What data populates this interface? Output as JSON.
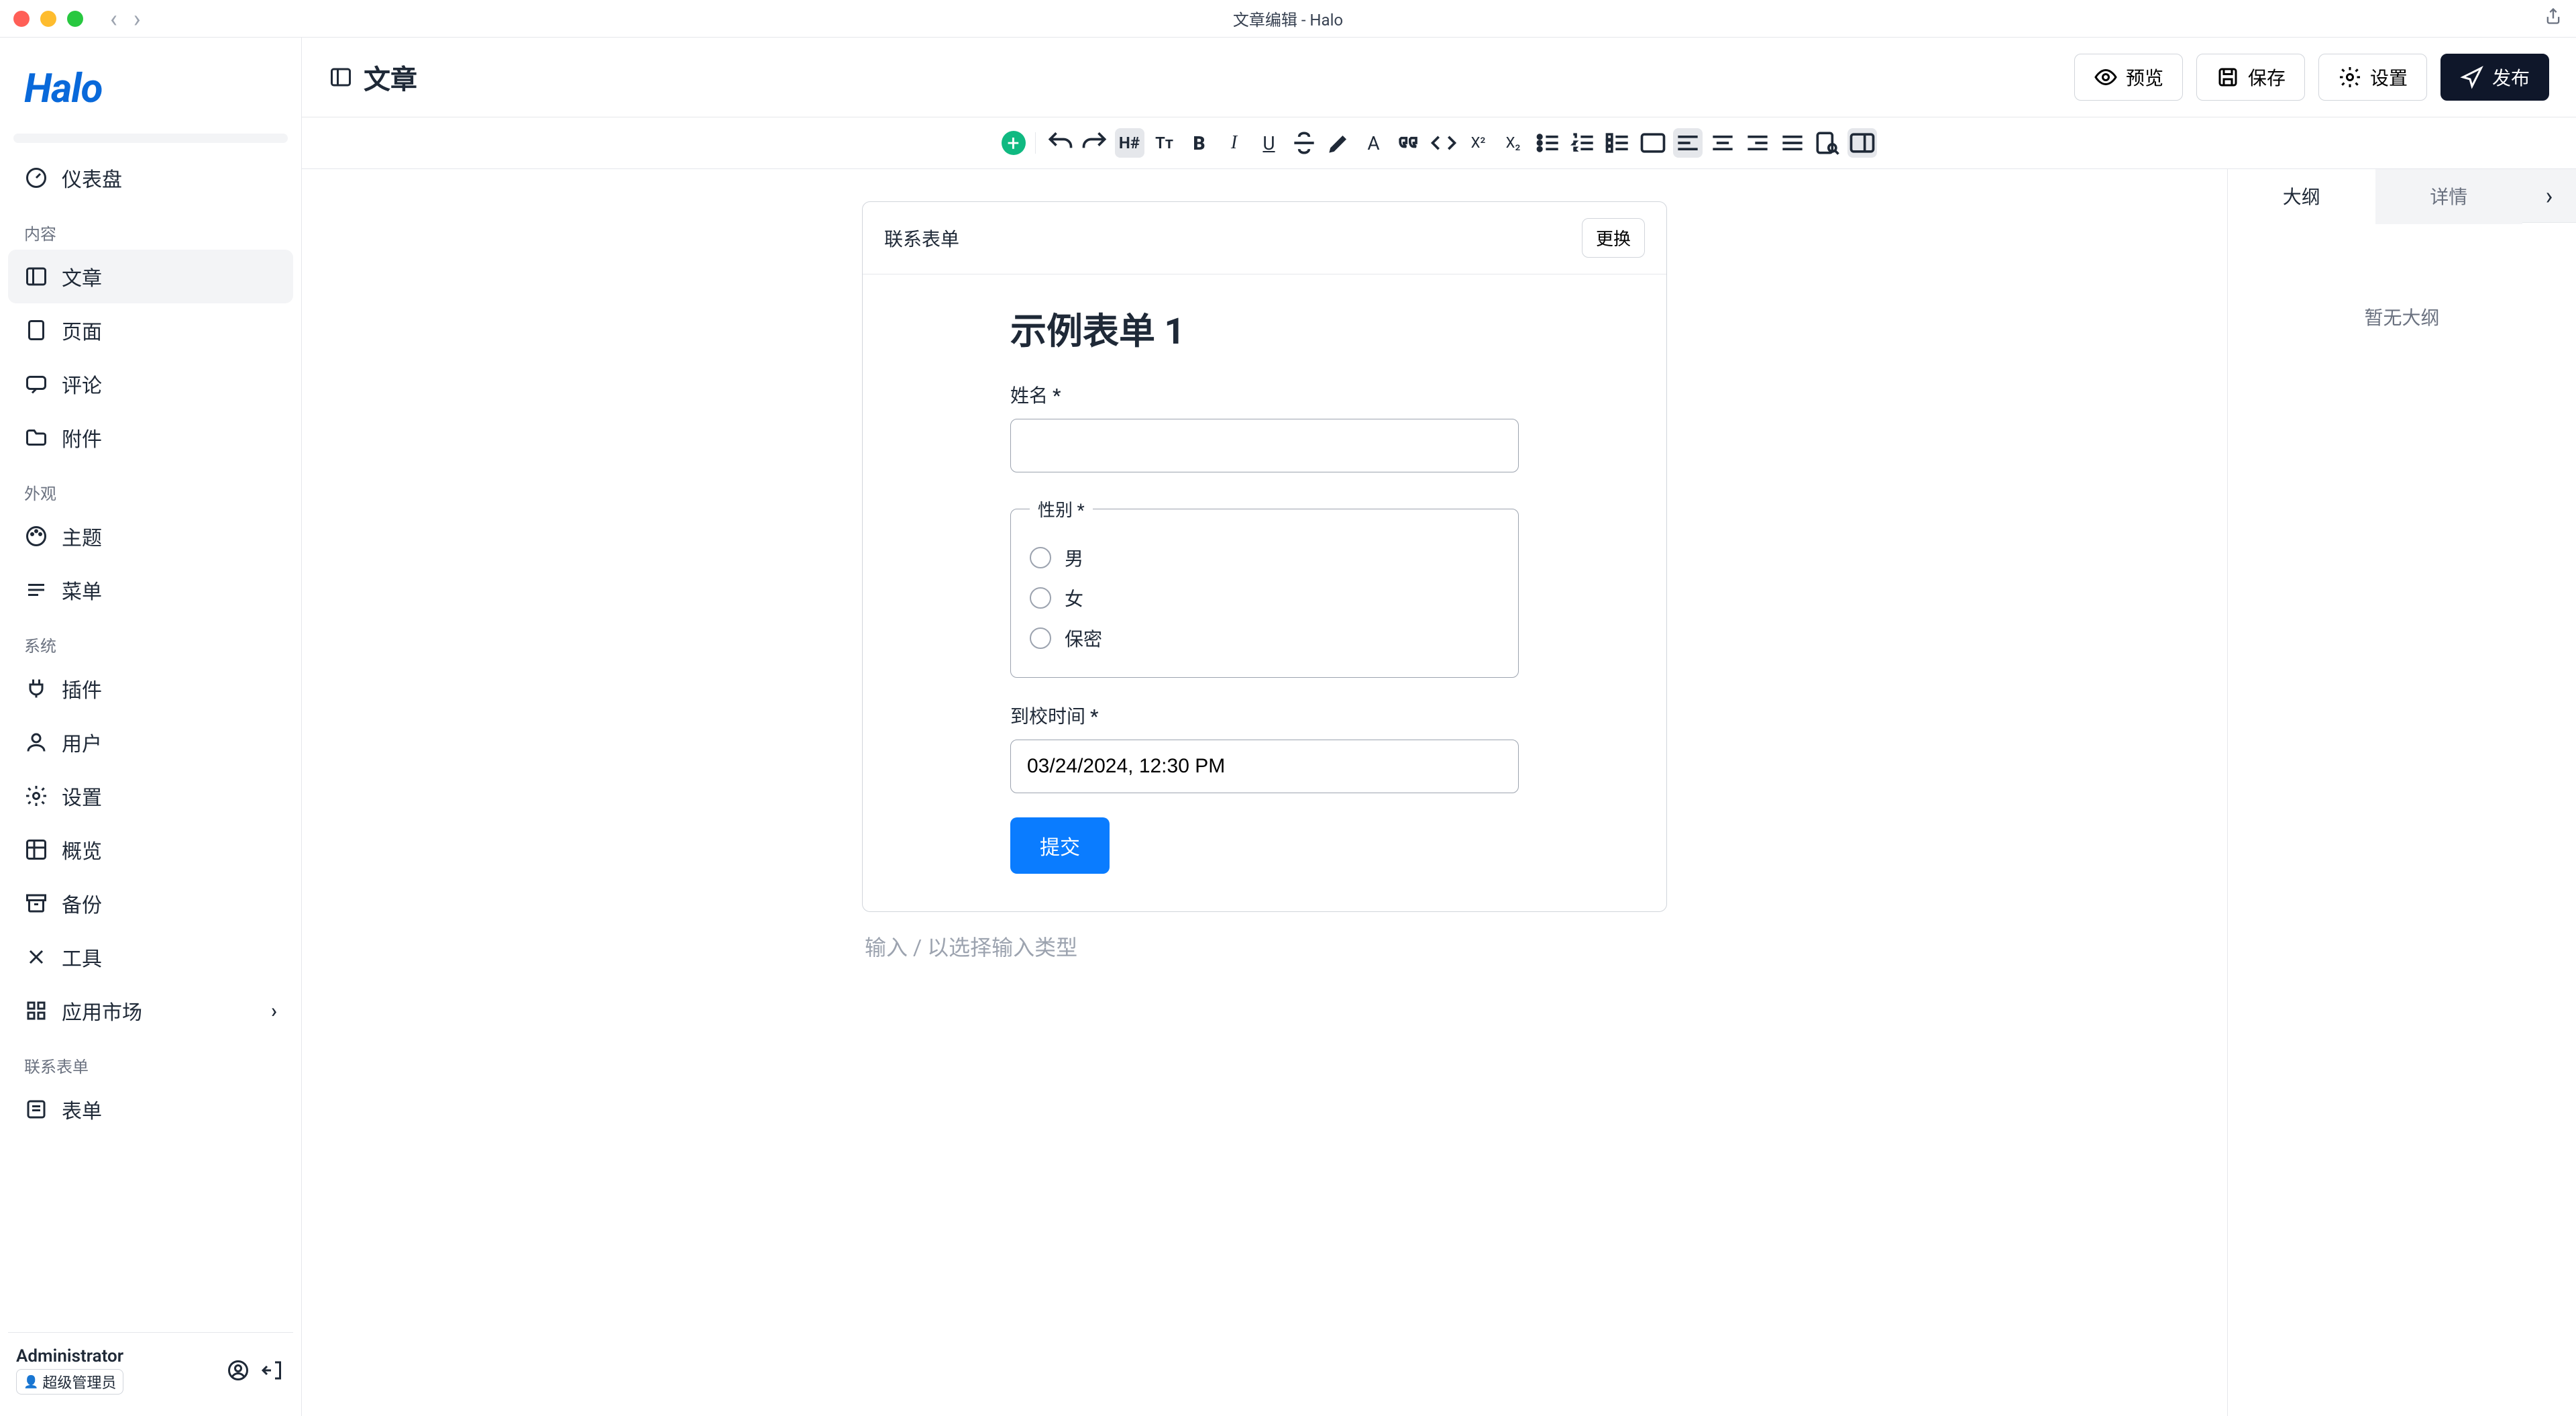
{
  "window": {
    "title": "文章编辑 - Halo"
  },
  "logo": "Halo",
  "sidebar": {
    "dashboard": "仪表盘",
    "sections": {
      "content": "内容",
      "appearance": "外观",
      "system": "系统",
      "contact_form": "联系表单"
    },
    "items": {
      "posts": "文章",
      "pages": "页面",
      "comments": "评论",
      "attachments": "附件",
      "themes": "主题",
      "menus": "菜单",
      "plugins": "插件",
      "users": "用户",
      "settings": "设置",
      "overview": "概览",
      "backup": "备份",
      "tools": "工具",
      "market": "应用市场",
      "forms": "表单"
    },
    "footer": {
      "name": "Administrator",
      "role": "超级管理员"
    }
  },
  "header": {
    "title": "文章",
    "preview": "预览",
    "save": "保存",
    "settings": "设置",
    "publish": "发布"
  },
  "toolbar": {
    "heading": "H#",
    "tt": "Tт",
    "bold": "B",
    "italic": "I",
    "underline": "U",
    "font": "A",
    "sup": "X²",
    "sub": "X₂"
  },
  "editor": {
    "card_title": "联系表单",
    "change": "更换",
    "form_title": "示例表单 1",
    "name_label": "姓名 *",
    "gender_label": "性别 *",
    "gender_options": {
      "male": "男",
      "female": "女",
      "secret": "保密"
    },
    "arrival_label": "到校时间 *",
    "arrival_value": "03/24/2024, 12:30 PM",
    "submit": "提交",
    "placeholder": "输入 / 以选择输入类型"
  },
  "right_panel": {
    "tabs": {
      "outline": "大纲",
      "details": "详情"
    },
    "empty": "暂无大纲"
  }
}
